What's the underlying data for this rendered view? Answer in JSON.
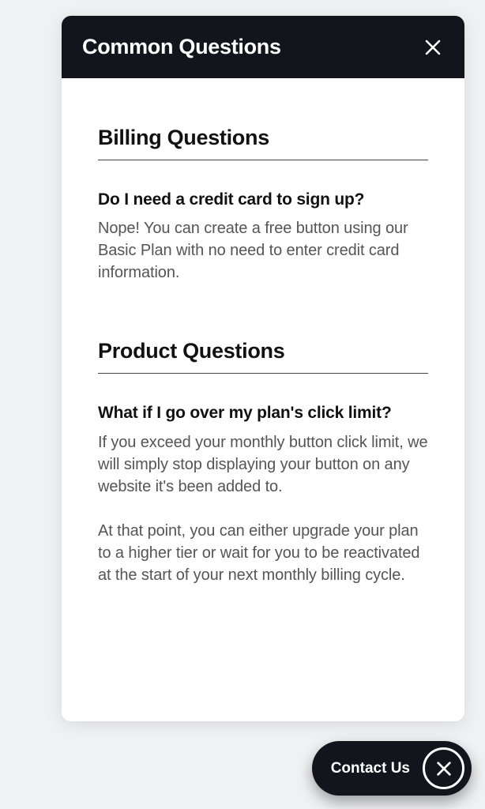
{
  "header": {
    "title": "Common Questions"
  },
  "sections": [
    {
      "title": "Billing Questions",
      "items": [
        {
          "question": "Do I need a credit card to sign up?",
          "answer": "Nope! You can create a free button using our Basic Plan with no need to enter credit card information."
        }
      ]
    },
    {
      "title": "Product Questions",
      "items": [
        {
          "question": "What if I go over my plan's click limit?",
          "answer": "If you exceed your monthly button click limit, we will simply stop displaying your button on any website it's been added to.\n\nAt that point, you can either upgrade your plan to a higher tier or wait for you to be reactivated at the start of your next monthly billing cycle."
        }
      ]
    }
  ],
  "fab": {
    "label": "Contact Us"
  }
}
